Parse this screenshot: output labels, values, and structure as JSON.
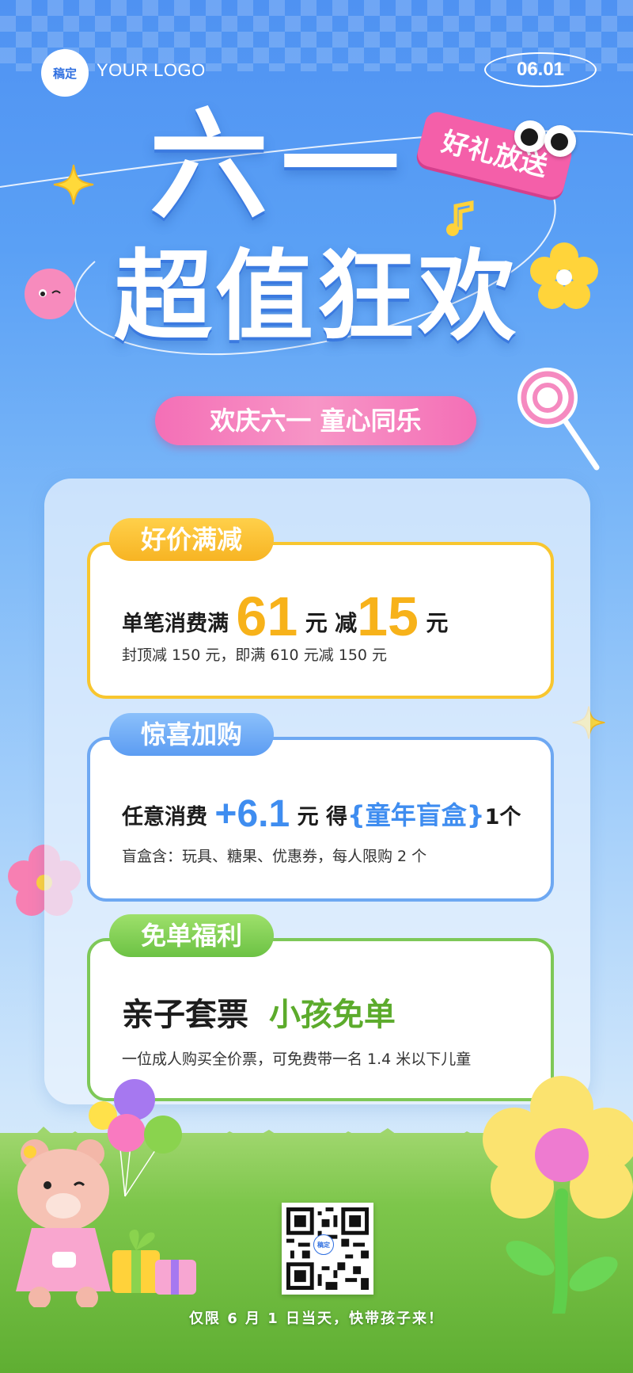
{
  "header": {
    "logo_mark": "稿定",
    "logo_text": "YOUR LOGO",
    "date": "06.01"
  },
  "hero": {
    "title_line1": "六一",
    "title_line2": "超值狂欢",
    "gift_tag": "好礼放送",
    "subtitle": "欢庆六一  童心同乐"
  },
  "cards": {
    "discount": {
      "badge": "好价满减",
      "main_prefix": "单笔消费满",
      "amount1": "61",
      "unit1": "元",
      "mid": "减",
      "amount2": "15",
      "unit2": "元",
      "note": "封顶减 150 元，即满 610 元减 150 元"
    },
    "addon": {
      "badge": "惊喜加购",
      "main_prefix": "任意消费",
      "amount": "+6.1",
      "unit": "元",
      "mid": "得",
      "item": "{童年盲盒}",
      "qty": "1个",
      "note": "盲盒含：玩具、糖果、优惠券，每人限购 2 个"
    },
    "free": {
      "badge": "免单福利",
      "main_black": "亲子套票",
      "main_green": "小孩免单",
      "note": "一位成人购买全价票，可免费带一名 1.4 米以下儿童"
    }
  },
  "footer": {
    "qr_logo": "稿定",
    "text": "仅限 6 月 1 日当天，快带孩子来！"
  },
  "colors": {
    "sky_blue": "#4f92f2",
    "yellow": "#f7b21a",
    "blue": "#3f8df0",
    "green": "#5cab2c",
    "pink": "#f45fa9"
  }
}
